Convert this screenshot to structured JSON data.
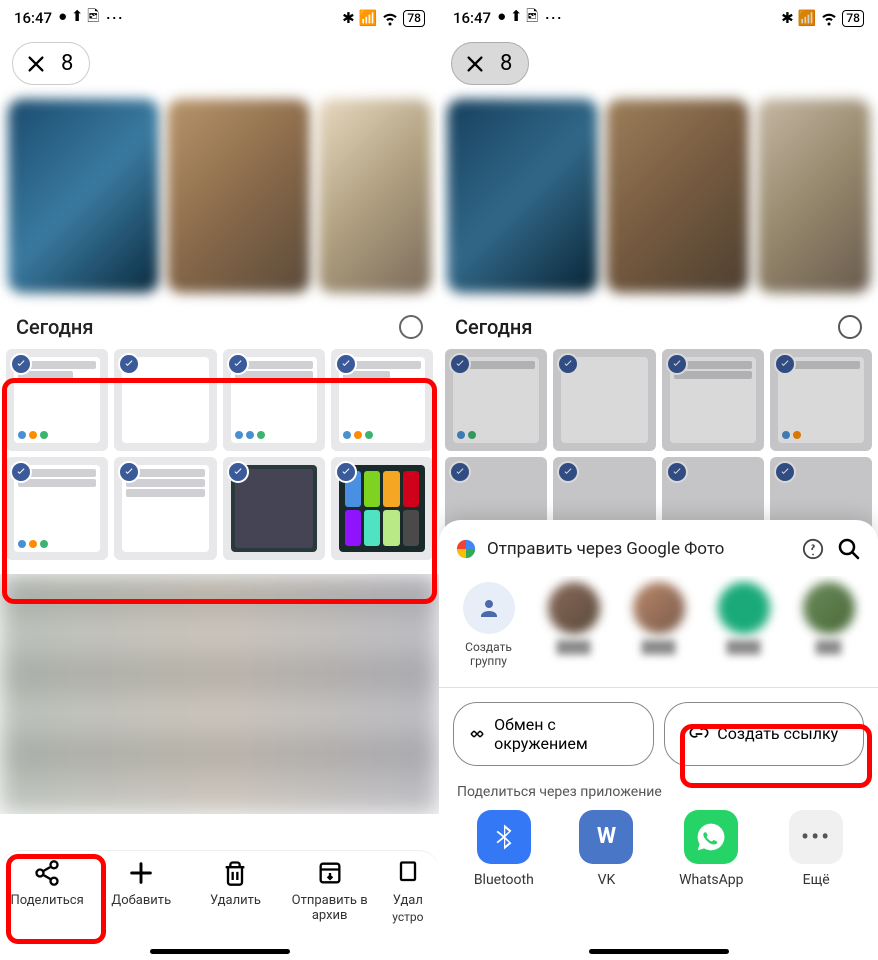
{
  "status": {
    "time": "16:47",
    "battery": "78"
  },
  "selection": {
    "count": "8"
  },
  "section": {
    "today": "Сегодня"
  },
  "bottom": {
    "share": "Поделиться",
    "add": "Добавить",
    "delete": "Удалить",
    "archive": "Отправить в архив",
    "trash_start": "Удал",
    "trash_sub": "устро"
  },
  "share_sheet": {
    "title": "Отправить через Google Фото",
    "create_group": "Создать группу",
    "nearby": "Обмен с окружением",
    "create_link": "Создать ссылку",
    "apps_caption": "Поделиться через приложение",
    "apps": {
      "bluetooth": "Bluetooth",
      "vk": "VK",
      "whatsapp": "WhatsApp",
      "more": "Ещё"
    }
  }
}
